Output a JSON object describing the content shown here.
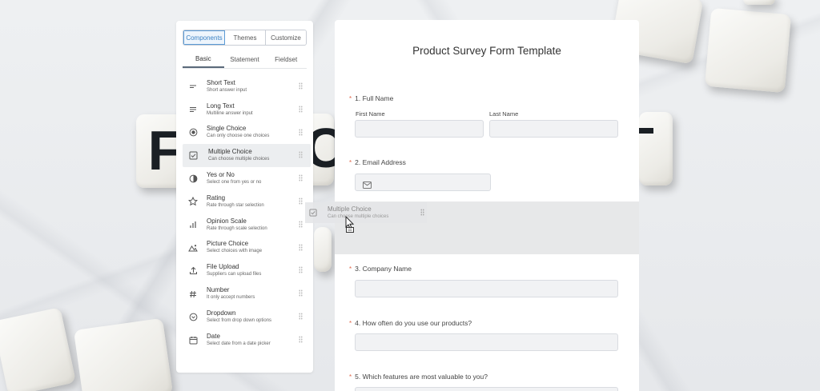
{
  "panel": {
    "tabs": [
      {
        "label": "Components",
        "active": true
      },
      {
        "label": "Themes",
        "active": false
      },
      {
        "label": "Customize",
        "active": false
      }
    ],
    "subtabs": [
      {
        "label": "Basic",
        "active": true
      },
      {
        "label": "Statement",
        "active": false
      },
      {
        "label": "Fieldset",
        "active": false
      }
    ],
    "components": [
      {
        "title": "Short Text",
        "desc": "Short answer input",
        "icon": "short-text-icon"
      },
      {
        "title": "Long Text",
        "desc": "Multiline answer input",
        "icon": "long-text-icon"
      },
      {
        "title": "Single Choice",
        "desc": "Can only choose one choices",
        "icon": "radio-icon"
      },
      {
        "title": "Multiple Choice",
        "desc": "Can choose multiple choices",
        "icon": "checkbox-icon"
      },
      {
        "title": "Yes or No",
        "desc": "Select one from yes or no",
        "icon": "half-circle-icon"
      },
      {
        "title": "Rating",
        "desc": "Rate through star selection",
        "icon": "star-icon"
      },
      {
        "title": "Opinion Scale",
        "desc": "Rate through scale selection",
        "icon": "bar-chart-icon"
      },
      {
        "title": "Picture Choice",
        "desc": "Select choices with image",
        "icon": "image-icon"
      },
      {
        "title": "File Upload",
        "desc": "Suppliers can upload files",
        "icon": "upload-icon"
      },
      {
        "title": "Number",
        "desc": "It only accept numbers",
        "icon": "hash-icon"
      },
      {
        "title": "Dropdown",
        "desc": "Select from drop down options",
        "icon": "dropdown-icon"
      },
      {
        "title": "Date",
        "desc": "Select date from a date picker",
        "icon": "calendar-icon"
      }
    ]
  },
  "form": {
    "title": "Product Survey Form Template",
    "q1": {
      "label": "1. Full Name",
      "first": "First Name",
      "last": "Last Name"
    },
    "q2": {
      "label": "2. Email Address"
    },
    "q3": {
      "label": "3. Company Name"
    },
    "q4": {
      "label": "4. How often do you use our products?"
    },
    "q5": {
      "label": "5. Which features are most valuable to you?"
    },
    "required_mark": "*"
  },
  "ghost": {
    "title": "Multiple Choice",
    "desc": "Can choose multiple choices",
    "icon": "checkbox-icon"
  },
  "background": {
    "tile_letters": [
      "F",
      "O",
      "T"
    ]
  },
  "colors": {
    "accent": "#3b82c4",
    "required": "#e0684b",
    "field_bg": "#f1f2f4",
    "dropzone": "#e7e8e9"
  }
}
